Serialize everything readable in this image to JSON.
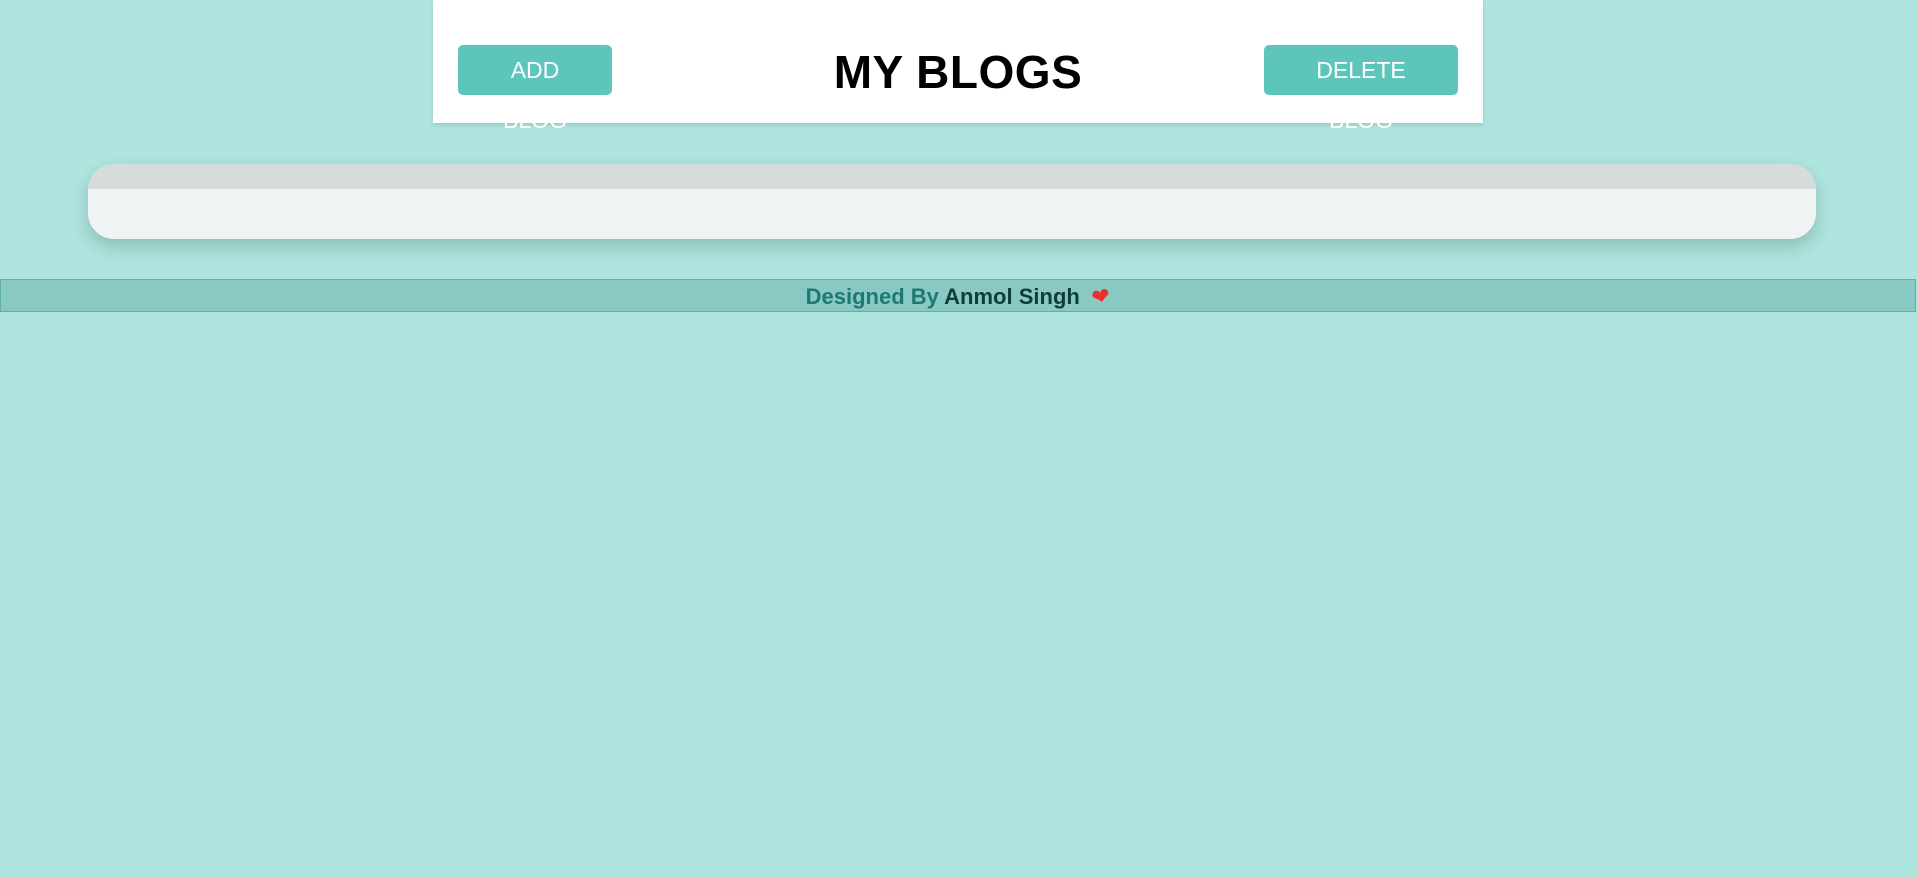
{
  "header": {
    "add_label": "ADD BLOG",
    "title": "MY BLOGS",
    "delete_label": "DELETE BLOG"
  },
  "footer": {
    "prefix": "Designed By",
    "name": "Anmol Singh",
    "heart_icon": "heart-icon"
  },
  "colors": {
    "background": "#aee5df",
    "button": "#5ec5bb",
    "footer_bar": "#8ac9c3",
    "heart": "#ef2b2b"
  }
}
